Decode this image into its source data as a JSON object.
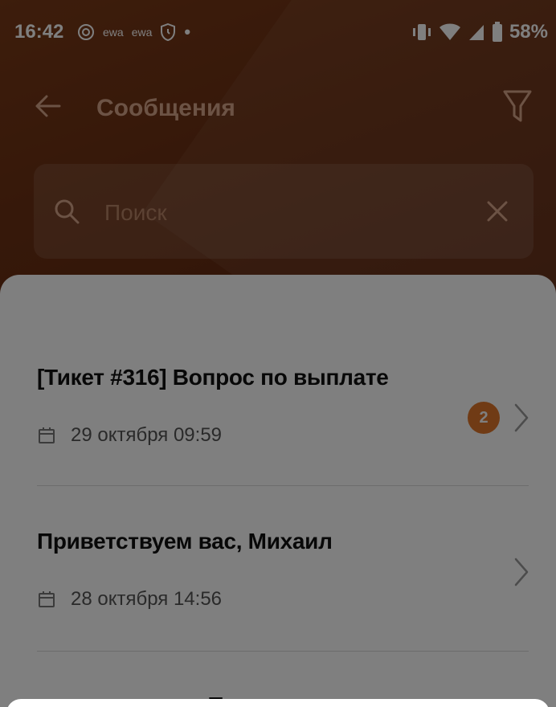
{
  "status_bar": {
    "time": "16:42",
    "notif_a": "ewa",
    "notif_b": "ewa",
    "dot": "•",
    "battery": "58%"
  },
  "header": {
    "title": "Сообщения"
  },
  "search": {
    "placeholder": "Поиск"
  },
  "messages": [
    {
      "title": "[Тикет #316] Вопрос по выплате",
      "date": "29 октября 09:59",
      "badge": "2"
    },
    {
      "title": "Приветствуем вас, Михаил",
      "date": "28 октября 14:56"
    }
  ],
  "partial_item": {
    "title": "Т"
  },
  "colors": {
    "accent": "#e0772a",
    "header": "#6d3114"
  }
}
